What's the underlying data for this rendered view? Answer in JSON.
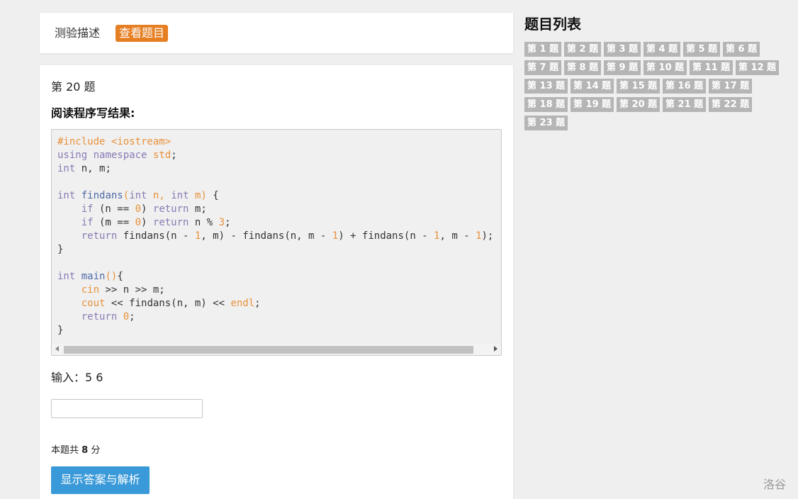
{
  "tabs": {
    "description": "测验描述",
    "view_problems": "查看题目"
  },
  "question": {
    "number": "第 20 题",
    "title": "阅读程序写结果:",
    "input_label": "输入：5 6",
    "answer_value": "",
    "score_prefix": "本题共",
    "score_value": "8",
    "score_suffix": "分",
    "show_answer_button": "显示答案与解析"
  },
  "code": "#include <iostream>\nusing namespace std;\nint n, m;\n\nint findans(int n, int m) {\n    if (n == 0) return m;\n    if (m == 0) return n % 3;\n    return findans(n - 1, m) - findans(n, m - 1) + findans(n - 1, m - 1);\n}\n\nint main(){\n    cin >> n >> m;\n    cout << findans(n, m) << endl;\n    return 0;\n}",
  "problem_list": {
    "title": "题目列表",
    "items": [
      "第 1 题",
      "第 2 题",
      "第 3 题",
      "第 4 题",
      "第 5 题",
      "第 6 题",
      "第 7 题",
      "第 8 题",
      "第 9 题",
      "第 10 题",
      "第 11 题",
      "第 12 题",
      "第 13 题",
      "第 14 题",
      "第 15 题",
      "第 16 题",
      "第 17 题",
      "第 18 题",
      "第 19 题",
      "第 20 题",
      "第 21 题",
      "第 22 题",
      "第 23 题"
    ]
  },
  "footer": {
    "logo": "洛谷"
  },
  "colors": {
    "accent_tab": "#e67e22",
    "button_blue": "#3a9ad9",
    "list_item_gray": "#b5b5b5"
  },
  "icons": [
    "scroll-left-arrow-icon",
    "scroll-right-arrow-icon"
  ]
}
